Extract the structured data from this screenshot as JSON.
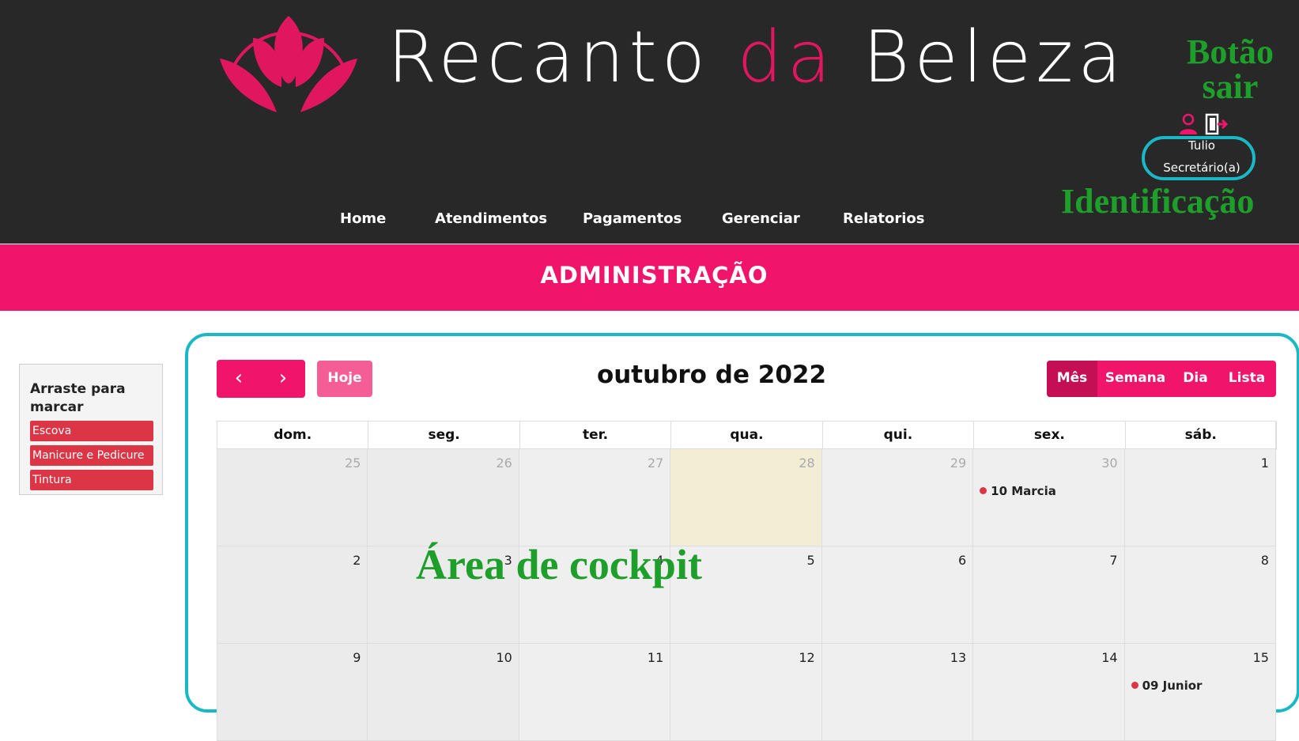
{
  "brand": {
    "part1": "Recanto ",
    "accent": "da",
    "part2": " Beleza",
    "accent_color": "#e0175f"
  },
  "annotations": {
    "exit_line1": "Botão",
    "exit_line2": "sair",
    "identification": "Identificação",
    "cockpit": "Área de cockpit"
  },
  "user": {
    "name": "Tulio",
    "role": "Secretário(a)",
    "icons": [
      "user-icon",
      "exit-icon"
    ]
  },
  "nav": {
    "items": [
      "Home",
      "Atendimentos",
      "Pagamentos",
      "Gerenciar",
      "Relatorios"
    ]
  },
  "banner": {
    "title": "ADMINISTRAÇÃO",
    "color": "#f0156a"
  },
  "drag_panel": {
    "title": "Arraste para marcar",
    "items": [
      "Escova",
      "Manicure e Pedicure",
      "Tintura"
    ]
  },
  "calendar": {
    "prev_icon": "‹",
    "next_icon": "›",
    "today_label": "Hoje",
    "title": "outubro de 2022",
    "views": [
      "Mês",
      "Semana",
      "Dia",
      "Lista"
    ],
    "active_view": "Mês",
    "days_of_week": [
      "dom.",
      "seg.",
      "ter.",
      "qua.",
      "qui.",
      "sex.",
      "sáb."
    ],
    "weeks": [
      [
        {
          "n": "25",
          "muted": true
        },
        {
          "n": "26",
          "muted": true
        },
        {
          "n": "27",
          "muted": true
        },
        {
          "n": "28",
          "muted": true,
          "today": true
        },
        {
          "n": "29",
          "muted": true
        },
        {
          "n": "30",
          "muted": true,
          "event": "10 Marcia"
        },
        {
          "n": "1"
        }
      ],
      [
        {
          "n": "2"
        },
        {
          "n": "3"
        },
        {
          "n": "4"
        },
        {
          "n": "5"
        },
        {
          "n": "6"
        },
        {
          "n": "7"
        },
        {
          "n": "8"
        }
      ],
      [
        {
          "n": "9"
        },
        {
          "n": "10"
        },
        {
          "n": "11"
        },
        {
          "n": "12"
        },
        {
          "n": "13"
        },
        {
          "n": "14"
        },
        {
          "n": "15",
          "event": "09 Junior"
        }
      ]
    ]
  }
}
